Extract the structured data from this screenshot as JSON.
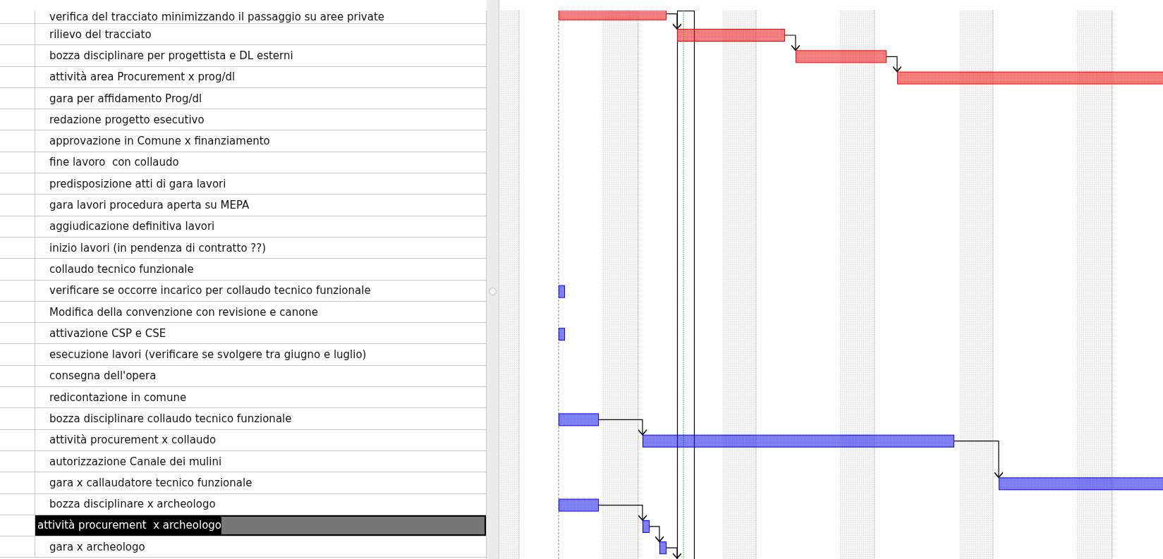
{
  "tasks": [
    {
      "name": "verifica del tracciato minimizzando il passaggio su aree private",
      "selected": false,
      "color": "#ff0000"
    },
    {
      "name": "rilievo del tracciato",
      "selected": false,
      "color": "#ff0000"
    },
    {
      "name": "bozza disciplinare per progettista e DL esterni",
      "selected": false,
      "color": "#ff0000"
    },
    {
      "name": "attività area Procurement x prog/dl",
      "selected": false,
      "color": "#ff0000"
    },
    {
      "name": "gara per affidamento Prog/dl",
      "selected": false
    },
    {
      "name": "redazione progetto esecutivo",
      "selected": false
    },
    {
      "name": "approvazione in Comune x finanziamento",
      "selected": false
    },
    {
      "name": "fine lavoro  con collaudo",
      "selected": false
    },
    {
      "name": "predisposizione atti di gara lavori",
      "selected": false
    },
    {
      "name": "gara lavori procedura aperta su MEPA",
      "selected": false
    },
    {
      "name": "aggiudicazione definitiva lavori",
      "selected": false
    },
    {
      "name": "inizio lavori (in pendenza di contratto ??)",
      "selected": false
    },
    {
      "name": "collaudo tecnico funzionale",
      "selected": false
    },
    {
      "name": "verificare se occorre incarico per collaudo tecnico funzionale",
      "selected": false,
      "color": "#0000ff"
    },
    {
      "name": "Modifica della convenzione con revisione e canone",
      "selected": false
    },
    {
      "name": "attivazione CSP e CSE",
      "selected": false,
      "color": "#0000ff"
    },
    {
      "name": "esecuzione lavori (verificare se svolgere tra giugno e luglio)",
      "selected": false
    },
    {
      "name": "consegna dell'opera",
      "selected": false
    },
    {
      "name": "redicontazione in comune",
      "selected": false
    },
    {
      "name": "bozza disciplinare collaudo tecnico funzionale",
      "selected": false,
      "color": "#0000ff"
    },
    {
      "name": "attività procurement x collaudo",
      "selected": false,
      "color": "#0000ff"
    },
    {
      "name": "autorizzazione Canale dei mulini",
      "selected": false
    },
    {
      "name": "gara x callaudatore tecnico funzionale",
      "selected": false,
      "color": "#0000ff"
    },
    {
      "name": "bozza disciplinare x archeologo",
      "selected": false,
      "color": "#0000ff"
    },
    {
      "name": "attività procurement  x archeologo",
      "selected": true,
      "color": "#0000ff"
    },
    {
      "name": "gara x archeologo",
      "selected": false,
      "color": "#0000ff"
    }
  ]
}
